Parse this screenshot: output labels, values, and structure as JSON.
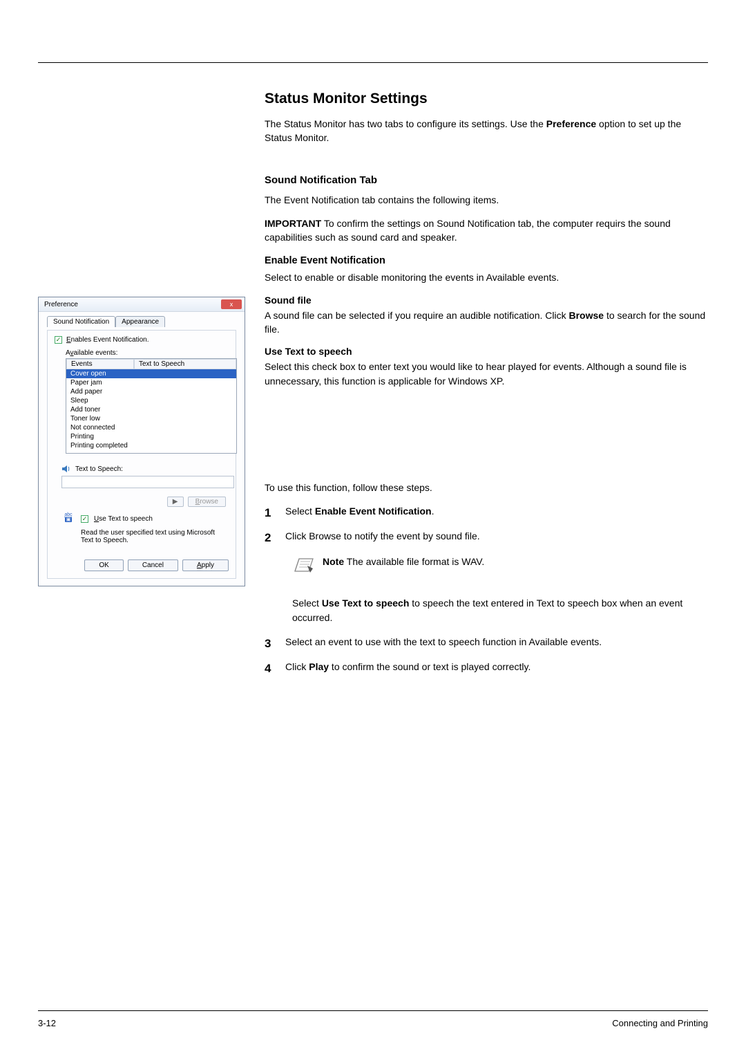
{
  "page": {
    "number": "3-12",
    "section": "Connecting and Printing"
  },
  "heading": "Status Monitor Settings",
  "intro": {
    "line1": "The Status Monitor has two tabs to configure its settings. Use the ",
    "pref": "Preference",
    "line2": " option to set up the Status Monitor."
  },
  "soundTab": {
    "heading": "Sound Notification Tab",
    "desc": "The Event Notification tab contains the following items.",
    "important_label": "IMPORTANT",
    "important_text": "  To confirm the settings on Sound Notification tab, the computer requirs the sound capabilities such as sound card and speaker."
  },
  "enable": {
    "heading": "Enable Event Notification",
    "desc": "Select to enable or disable monitoring the events in Available events.",
    "soundfile_h": "Sound file",
    "soundfile_p1": "A sound file can be selected if you require an audible notification. Click ",
    "soundfile_b": "Browse",
    "soundfile_p2": " to search for the sound file.",
    "utts_h": "Use Text to speech",
    "utts_p": "Select this check box to enter text you would like to hear played for events. Although a sound file is unnecessary, this function is applicable for Windows XP."
  },
  "steps": {
    "lead": "To use this function, follow these steps.",
    "s1a": "Select ",
    "s1b": "Enable Event Notification",
    "s1c": ".",
    "s2": "Click Browse to notify the event by sound file.",
    "note_b": "Note",
    "note_t": "  The available file format is WAV.",
    "s2b_a": "Select ",
    "s2b_b": "Use Text to speech",
    "s2b_c": " to speech the text entered in Text to speech box when an event occurred.",
    "s3": "Select an event to use with the text to speech function in Available events.",
    "s4a": "Click ",
    "s4b": "Play",
    "s4c": " to confirm the sound or text is played correctly."
  },
  "dialog": {
    "title": "Preference",
    "close": "x",
    "tab1": "Sound Notification",
    "tab2": "Appearance",
    "enable_chk": "Enables Event Notification.",
    "avail_lbl": "Available events:",
    "col1": "Events",
    "col2": "Text to Speech",
    "events": [
      "Cover open",
      "Paper jam",
      "Add paper",
      "Sleep",
      "Add toner",
      "Toner low",
      "Not connected",
      "Printing",
      "Printing completed"
    ],
    "tts_lbl": "Text to Speech:",
    "play_btn": "▶",
    "browse_btn": "Browse",
    "uts_chk": "Use Text to speech",
    "uts_desc": "Read the user specified text using Microsoft Text to Speech.",
    "ok": "OK",
    "cancel": "Cancel",
    "apply": "Apply"
  }
}
